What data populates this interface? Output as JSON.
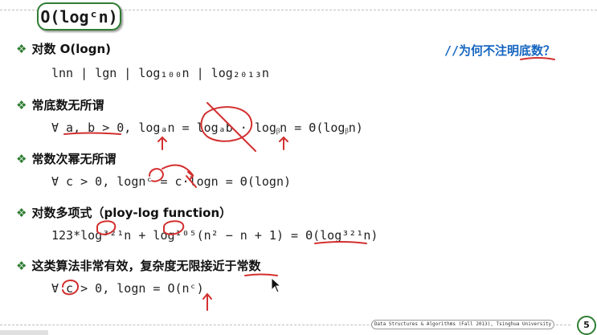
{
  "title": "O(logᶜn)",
  "side_note": "//为何不注明底数？",
  "sections": [
    {
      "bullet": "❖",
      "heading": "对数 O(logn)",
      "formula": "lnn | lgn | log₁₀₀n | log₂₀₁₃n"
    },
    {
      "bullet": "❖",
      "heading": "常底数无所谓",
      "formula": "∀ a, b > 0, logₐn  =  logₐb · logᵦn  =  Θ(logᵦn)"
    },
    {
      "bullet": "❖",
      "heading": "常数次幂无所谓",
      "formula": "∀ c > 0, lognᶜ  =  c·logn  =  Θ(logn)"
    },
    {
      "bullet": "❖",
      "heading": "对数多项式（ploy-log function）",
      "formula": "123*log³²¹n + log¹⁰⁵(n² − n + 1)  =  Θ(log³²¹n)"
    },
    {
      "bullet": "❖",
      "heading": "这类算法非常有效，复杂度无限接近于常数",
      "formula": "∀ c > 0, logn  =  O(nᶜ)"
    }
  ],
  "footer": "Data Structures & Algorithms (Fall 2013), Tsinghua University",
  "page_number": "5",
  "colors": {
    "accent": "#2e7d32",
    "ink": "#d32f2f",
    "note": "#1565c0"
  }
}
